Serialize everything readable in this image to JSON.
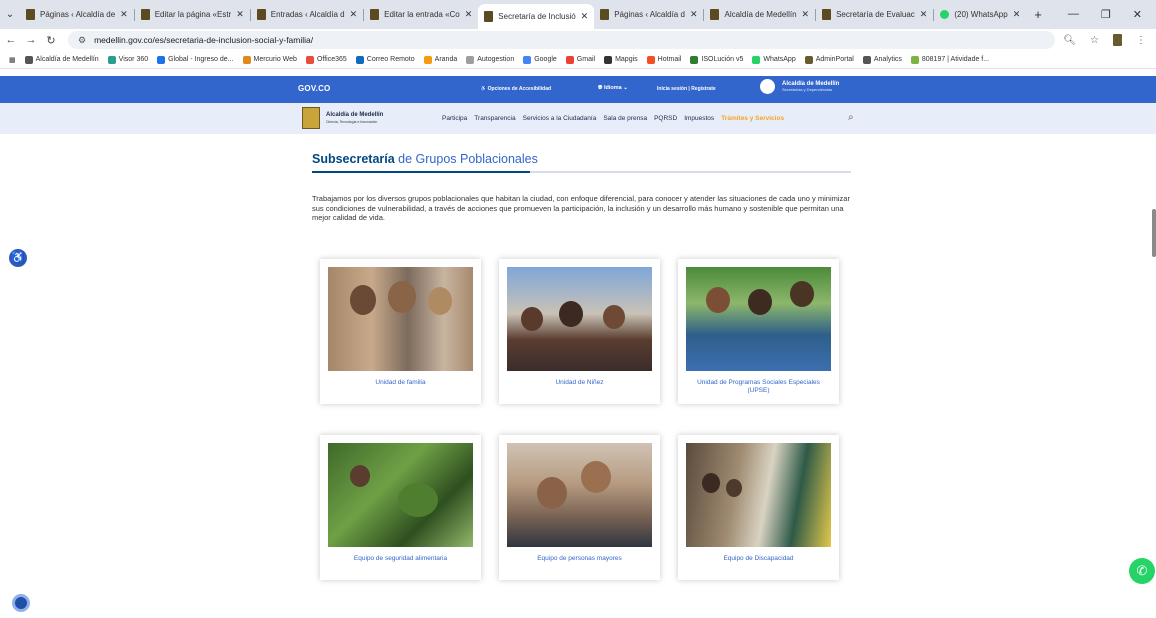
{
  "browser": {
    "tabs": [
      {
        "title": "Páginas ‹ Alcaldía de",
        "active": false,
        "icon": "wp-icon"
      },
      {
        "title": "Editar la página «Estr",
        "active": false,
        "icon": "wp-icon"
      },
      {
        "title": "Entradas ‹ Alcaldía d",
        "active": false,
        "icon": "wp-icon"
      },
      {
        "title": "Editar la entrada «Co",
        "active": false,
        "icon": "wp-icon"
      },
      {
        "title": "Secretaría de Inclusió",
        "active": true,
        "icon": "wp-icon"
      },
      {
        "title": "Páginas ‹ Alcaldía d",
        "active": false,
        "icon": "wp-icon"
      },
      {
        "title": "Alcaldía de Medellín",
        "active": false,
        "icon": "wp-icon"
      },
      {
        "title": "Secretaría de Evaluac",
        "active": false,
        "icon": "wp-icon"
      },
      {
        "title": "(20) WhatsApp",
        "active": false,
        "icon": "whatsapp-icon"
      }
    ],
    "url": "medellin.gov.co/es/secretaria-de-inclusion-social-y-familia/",
    "bookmarks": [
      {
        "label": "Alcaldía de Medellín",
        "color": "#555555"
      },
      {
        "label": "Visor 360",
        "color": "#2a9d8f"
      },
      {
        "label": "Global - Ingreso de...",
        "color": "#1a73e8"
      },
      {
        "label": "Mercurio Web",
        "color": "#e08a1e"
      },
      {
        "label": "Office365",
        "color": "#e74c3c"
      },
      {
        "label": "Correo Remoto",
        "color": "#0f6cbd"
      },
      {
        "label": "Aranda",
        "color": "#f39c12"
      },
      {
        "label": "Autogestion",
        "color": "#9e9e9e"
      },
      {
        "label": "Google",
        "color": "#4285f4"
      },
      {
        "label": "Gmail",
        "color": "#ea4335"
      },
      {
        "label": "Mapgis",
        "color": "#333333"
      },
      {
        "label": "Hotmail",
        "color": "#f25022"
      },
      {
        "label": "ISOLución v5",
        "color": "#2e7d32"
      },
      {
        "label": "WhatsApp",
        "color": "#25d366"
      },
      {
        "label": "AdminPortal",
        "color": "#6a5a30"
      },
      {
        "label": "Analytics",
        "color": "#555555"
      },
      {
        "label": "808197 | Atividade f...",
        "color": "#7cb342"
      }
    ]
  },
  "govbar": {
    "logo": "GOV.CO",
    "accessibility": "Opciones de Accesibilidad",
    "language": "Idioma",
    "login": "Inicia sesión  |  Regístrate",
    "entity": "Alcaldía de Medellín",
    "entity_sub": "Secretarías y Dependencias"
  },
  "menu": {
    "logo_title": "Alcaldía de Medellín",
    "logo_sub": "Ciencia, Tecnología e Innovación",
    "items": [
      "Participa",
      "Transparencia",
      "Servicios a la Ciudadanía",
      "Sala de prensa",
      "PQRSD",
      "Impuestos"
    ],
    "highlight": "Trámites y Servicios"
  },
  "section": {
    "title_bold": "Subsecretaría",
    "title_rest": " de Grupos Poblacionales",
    "intro": "Trabajamos por los diversos grupos poblacionales que habitan la ciudad, con enfoque diferencial, para conocer y atender las situaciones de cada uno y minimizar sus condiciones de vulnerabilidad, a través de acciones que promueven la participación, la inclusión y un desarrollo más humano y sostenible que permitan una mejor calidad de vida."
  },
  "cards": [
    {
      "label": "Unidad de familia"
    },
    {
      "label": "Unidad de Niñez"
    },
    {
      "label": "Unidad de Programas Sociales Especiales (UPSE)"
    },
    {
      "label": "Equipo de seguridad alimentaria"
    },
    {
      "label": "Equipo de personas mayores"
    },
    {
      "label": "Equipo de Discapacidad"
    }
  ]
}
